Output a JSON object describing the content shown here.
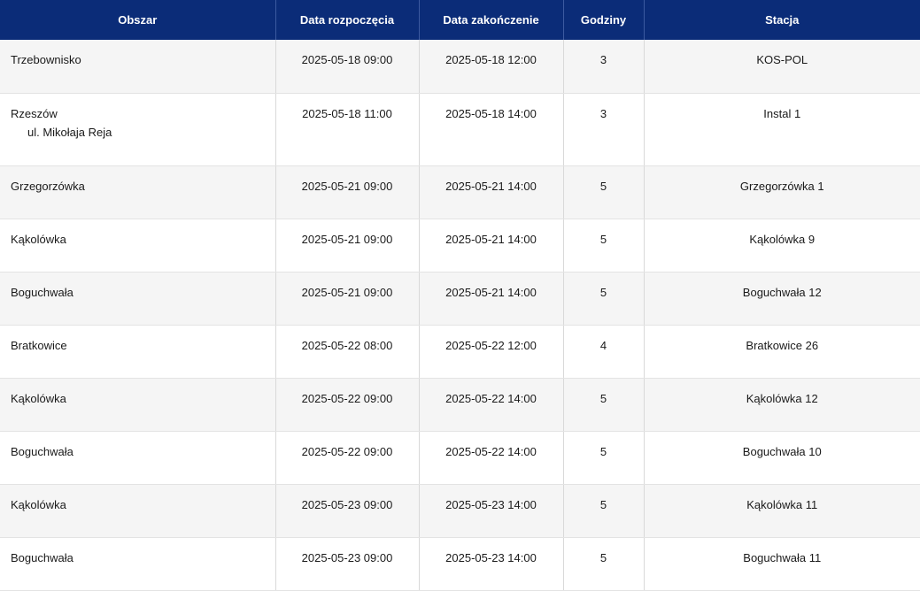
{
  "headers": {
    "area": "Obszar",
    "start": "Data rozpoczęcia",
    "end": "Data zakończenie",
    "hours": "Godziny",
    "station": "Stacja"
  },
  "rows": [
    {
      "area": "Trzebownisko",
      "sub": "",
      "start": "2025-05-18 09:00",
      "end": "2025-05-18 12:00",
      "hours": "3",
      "station": "KOS-POL"
    },
    {
      "area": "Rzeszów",
      "sub": "ul. Mikołaja Reja",
      "start": "2025-05-18 11:00",
      "end": "2025-05-18 14:00",
      "hours": "3",
      "station": "Instal 1"
    },
    {
      "area": "Grzegorzówka",
      "sub": "",
      "start": "2025-05-21 09:00",
      "end": "2025-05-21 14:00",
      "hours": "5",
      "station": "Grzegorzówka 1"
    },
    {
      "area": "Kąkolówka",
      "sub": "",
      "start": "2025-05-21 09:00",
      "end": "2025-05-21 14:00",
      "hours": "5",
      "station": "Kąkolówka 9"
    },
    {
      "area": "Boguchwała",
      "sub": "",
      "start": "2025-05-21 09:00",
      "end": "2025-05-21 14:00",
      "hours": "5",
      "station": "Boguchwała 12"
    },
    {
      "area": "Bratkowice",
      "sub": "",
      "start": "2025-05-22 08:00",
      "end": "2025-05-22 12:00",
      "hours": "4",
      "station": "Bratkowice 26"
    },
    {
      "area": "Kąkolówka",
      "sub": "",
      "start": "2025-05-22 09:00",
      "end": "2025-05-22 14:00",
      "hours": "5",
      "station": "Kąkolówka 12"
    },
    {
      "area": "Boguchwała",
      "sub": "",
      "start": "2025-05-22 09:00",
      "end": "2025-05-22 14:00",
      "hours": "5",
      "station": "Boguchwała 10"
    },
    {
      "area": "Kąkolówka",
      "sub": "",
      "start": "2025-05-23 09:00",
      "end": "2025-05-23 14:00",
      "hours": "5",
      "station": "Kąkolówka 11"
    },
    {
      "area": "Boguchwała",
      "sub": "",
      "start": "2025-05-23 09:00",
      "end": "2025-05-23 14:00",
      "hours": "5",
      "station": "Boguchwała 11"
    }
  ]
}
